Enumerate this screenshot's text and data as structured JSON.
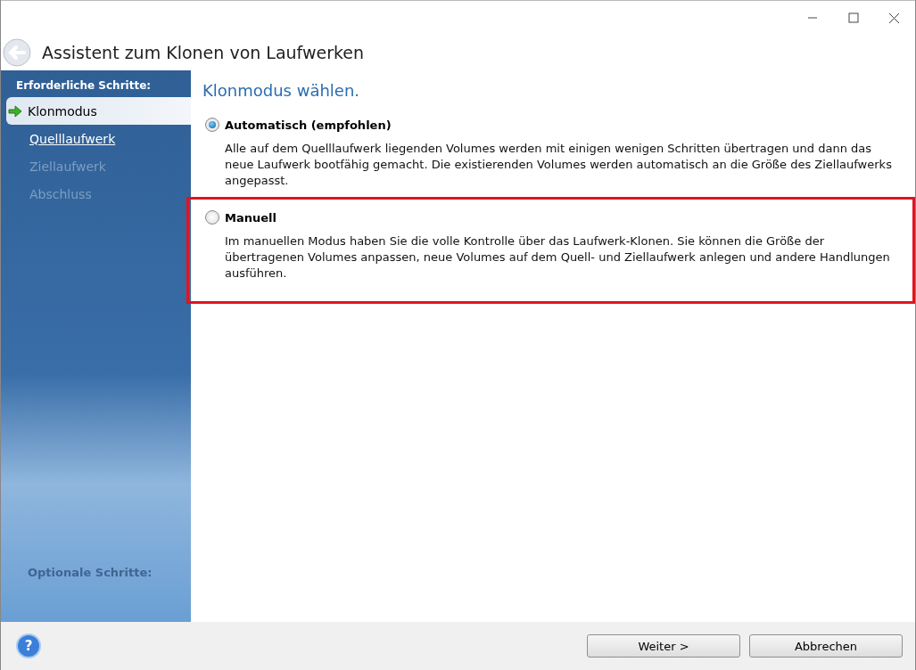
{
  "window": {
    "title": "Assistent zum Klonen von Laufwerken"
  },
  "sidebar": {
    "heading": "Erforderliche Schritte:",
    "steps": [
      {
        "label": "Klonmodus",
        "selected": true,
        "disabled": false
      },
      {
        "label": "Quelllaufwerk",
        "selected": false,
        "disabled": false
      },
      {
        "label": "Ziellaufwerk",
        "selected": false,
        "disabled": true
      },
      {
        "label": "Abschluss",
        "selected": false,
        "disabled": true
      }
    ],
    "optional_heading": "Optionale Schritte:"
  },
  "page": {
    "heading": "Klonmodus wählen.",
    "options": [
      {
        "label": "Automatisch (empfohlen)",
        "selected": true,
        "highlighted": false,
        "description": "Alle auf dem Quelllaufwerk liegenden Volumes werden mit einigen wenigen Schritten übertragen und dann das neue Laufwerk bootfähig gemacht. Die existierenden Volumes werden automatisch an die Größe des Ziellaufwerks angepasst."
      },
      {
        "label": "Manuell",
        "selected": false,
        "highlighted": true,
        "description": "Im manuellen Modus haben Sie die volle Kontrolle über das Laufwerk-Klonen. Sie können die Größe der übertragenen Volumes anpassen, neue Volumes auf dem Quell- und Ziellaufwerk anlegen und andere Handlungen ausführen."
      }
    ]
  },
  "help_button": "?",
  "buttons": [
    {
      "label": "Weiter >"
    },
    {
      "label": "Abbrechen"
    }
  ]
}
